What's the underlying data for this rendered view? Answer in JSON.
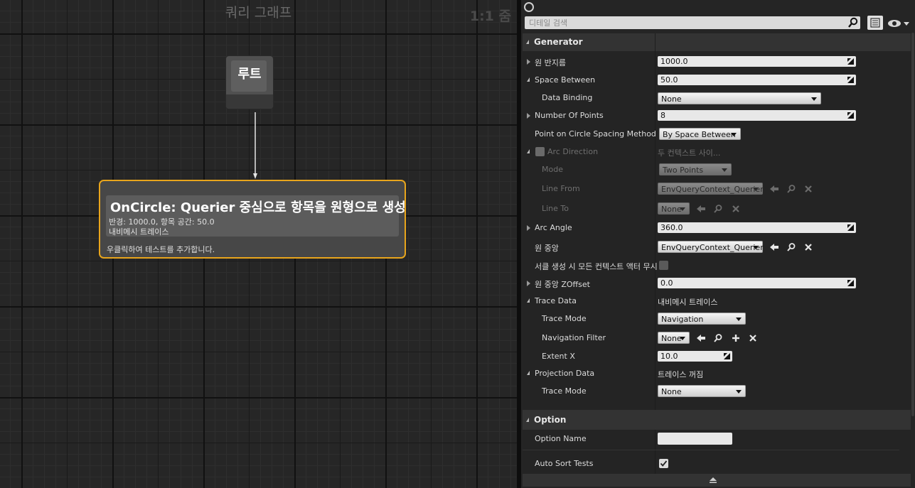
{
  "graph": {
    "title": "쿼리 그래프",
    "zoom": "1:1 줌",
    "root_node": {
      "label": "루트"
    },
    "generator_node": {
      "title": "OnCircle: Querier 중심으로 항목을 원형으로 생성",
      "subtitle1": "반경: 1000.0, 항목 공간: 50.0",
      "subtitle2": "내비메시 트레이스",
      "hint": "우클릭하여 테스트를 추가합니다."
    }
  },
  "details": {
    "search": {
      "placeholder": "디테일 검색",
      "value": ""
    },
    "sections": {
      "generator": "Generator",
      "option": "Option"
    },
    "rows": {
      "radius": {
        "label": "원 반지름",
        "value": "1000.0"
      },
      "space_between": {
        "label": "Space Between",
        "value": "50.0"
      },
      "data_binding": {
        "label": "Data Binding",
        "value": "None"
      },
      "number_of_points": {
        "label": "Number Of Points",
        "value": "8"
      },
      "spacing_method": {
        "label": "Point on Circle Spacing Method",
        "value": "By Space Between"
      },
      "arc_direction": {
        "label": "Arc Direction",
        "value": "두 컨텍스트 사이..."
      },
      "mode": {
        "label": "Mode",
        "value": "Two Points"
      },
      "line_from": {
        "label": "Line From",
        "value": "EnvQueryContext_Querier"
      },
      "line_to": {
        "label": "Line To",
        "value": "None"
      },
      "arc_angle": {
        "label": "Arc Angle",
        "value": "360.0"
      },
      "circle_center": {
        "label": "원 중앙",
        "value": "EnvQueryContext_Querier"
      },
      "ignore_actors": {
        "label": "서클 생성 시 모든 컨텍스트 액터 무시",
        "checked": false
      },
      "center_zoffset": {
        "label": "원 중앙 ZOffset",
        "value": "0.0"
      },
      "trace_data": {
        "label": "Trace Data",
        "value": "내비메시 트레이스"
      },
      "trace_mode": {
        "label": "Trace Mode",
        "value": "Navigation"
      },
      "navigation_filter": {
        "label": "Navigation Filter",
        "value": "None"
      },
      "extent_x": {
        "label": "Extent X",
        "value": "10.0"
      },
      "projection_data": {
        "label": "Projection Data",
        "value": "트레이스 꺼짐"
      },
      "proj_trace_mode": {
        "label": "Trace Mode",
        "value": "None"
      },
      "option_name": {
        "label": "Option Name",
        "value": ""
      },
      "auto_sort": {
        "label": "Auto Sort Tests",
        "checked": true
      }
    }
  },
  "colors": {
    "node_border": "#e8a51c",
    "panel_bg": "#252525",
    "graph_bg": "#262626"
  }
}
